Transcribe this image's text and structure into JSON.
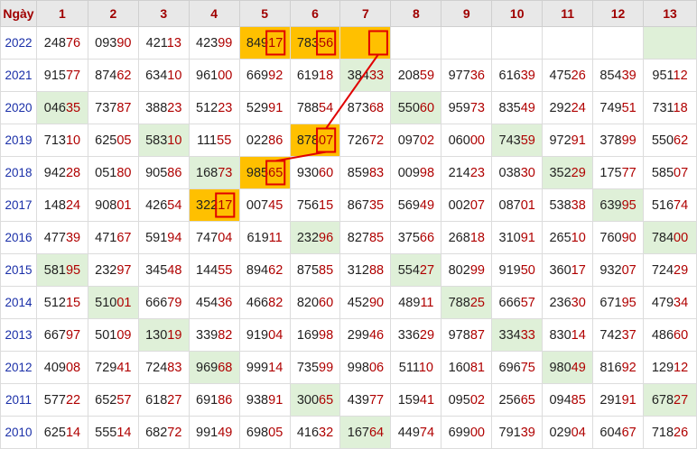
{
  "header": [
    "Ngày",
    "1",
    "2",
    "3",
    "4",
    "5",
    "6",
    "7",
    "8",
    "9",
    "10",
    "11",
    "12",
    "13"
  ],
  "rows": [
    {
      "year": "2022",
      "values": [
        "24876",
        "09390",
        "42113",
        "42399",
        "84917",
        "78356",
        "",
        "",
        "",
        "",
        "",
        "",
        ""
      ],
      "green": [
        13
      ],
      "gold": [
        5,
        6,
        7
      ],
      "boxed": [
        5,
        6,
        7
      ]
    },
    {
      "year": "2021",
      "values": [
        "91577",
        "87462",
        "63410",
        "96100",
        "66992",
        "61918",
        "38433",
        "20859",
        "97736",
        "61639",
        "47526",
        "85439",
        "95112"
      ],
      "green": [
        7
      ],
      "gold": [],
      "boxed": []
    },
    {
      "year": "2020",
      "values": [
        "04635",
        "73787",
        "38823",
        "51223",
        "52991",
        "78854",
        "87368",
        "55060",
        "95973",
        "83549",
        "29224",
        "74951",
        "73118"
      ],
      "green": [
        1,
        8
      ],
      "gold": [],
      "boxed": []
    },
    {
      "year": "2019",
      "values": [
        "71310",
        "62505",
        "58310",
        "11155",
        "02286",
        "87807",
        "72672",
        "09702",
        "06000",
        "74359",
        "97291",
        "37899",
        "55062"
      ],
      "green": [
        3,
        10
      ],
      "gold": [
        6
      ],
      "boxed": [
        6
      ]
    },
    {
      "year": "2018",
      "values": [
        "94228",
        "05180",
        "90586",
        "16873",
        "98565",
        "93060",
        "85983",
        "00998",
        "21423",
        "03830",
        "35229",
        "17577",
        "58507"
      ],
      "green": [
        4,
        11
      ],
      "gold": [
        5
      ],
      "boxed": [
        5
      ]
    },
    {
      "year": "2017",
      "values": [
        "14824",
        "90801",
        "42654",
        "32217",
        "00745",
        "75615",
        "86735",
        "56949",
        "00207",
        "08701",
        "53838",
        "63995",
        "51674"
      ],
      "green": [
        12
      ],
      "gold": [
        4
      ],
      "boxed": [
        4
      ]
    },
    {
      "year": "2016",
      "values": [
        "47739",
        "47167",
        "59194",
        "74704",
        "61911",
        "23296",
        "82785",
        "37566",
        "26818",
        "31091",
        "26510",
        "76090",
        "78400"
      ],
      "green": [
        6,
        13
      ],
      "gold": [],
      "boxed": []
    },
    {
      "year": "2015",
      "values": [
        "58195",
        "23297",
        "34548",
        "14455",
        "89462",
        "87585",
        "31288",
        "55427",
        "80299",
        "91950",
        "36017",
        "93207",
        "72429"
      ],
      "green": [
        1,
        8
      ],
      "gold": [],
      "boxed": []
    },
    {
      "year": "2014",
      "values": [
        "51215",
        "51001",
        "66679",
        "45436",
        "46682",
        "82060",
        "45290",
        "48911",
        "78825",
        "66657",
        "23630",
        "67195",
        "47934"
      ],
      "green": [
        2,
        9
      ],
      "gold": [],
      "boxed": []
    },
    {
      "year": "2013",
      "values": [
        "66797",
        "50109",
        "13019",
        "33982",
        "91904",
        "16998",
        "29946",
        "33629",
        "97887",
        "33433",
        "83014",
        "74237",
        "48660"
      ],
      "green": [
        3,
        10
      ],
      "gold": [],
      "boxed": []
    },
    {
      "year": "2012",
      "values": [
        "40908",
        "72941",
        "72483",
        "96968",
        "99914",
        "73599",
        "99806",
        "51110",
        "16081",
        "69675",
        "98049",
        "81692",
        "12912"
      ],
      "green": [
        4,
        11
      ],
      "gold": [],
      "boxed": []
    },
    {
      "year": "2011",
      "values": [
        "57722",
        "65257",
        "61827",
        "69186",
        "93891",
        "30065",
        "43977",
        "15941",
        "09502",
        "25665",
        "09485",
        "29191",
        "67827"
      ],
      "green": [
        6,
        13
      ],
      "gold": [],
      "boxed": []
    },
    {
      "year": "2010",
      "values": [
        "62514",
        "55514",
        "68272",
        "99149",
        "69805",
        "41632",
        "16764",
        "44974",
        "69900",
        "79139",
        "02904",
        "60467",
        "71826"
      ],
      "green": [
        7
      ],
      "gold": [],
      "boxed": []
    }
  ],
  "colors": {
    "tail": "#b00000",
    "green": "#dff0d8",
    "gold": "#ffc000",
    "line": "#e00000",
    "year": "#1a2fa8"
  },
  "connectors": [
    {
      "from": [
        5,
        4
      ],
      "to": [
        1,
        5
      ]
    },
    {
      "from": [
        4,
        5
      ],
      "to": [
        3,
        6
      ]
    },
    {
      "from": [
        3,
        6
      ],
      "to": [
        0,
        7
      ]
    }
  ]
}
